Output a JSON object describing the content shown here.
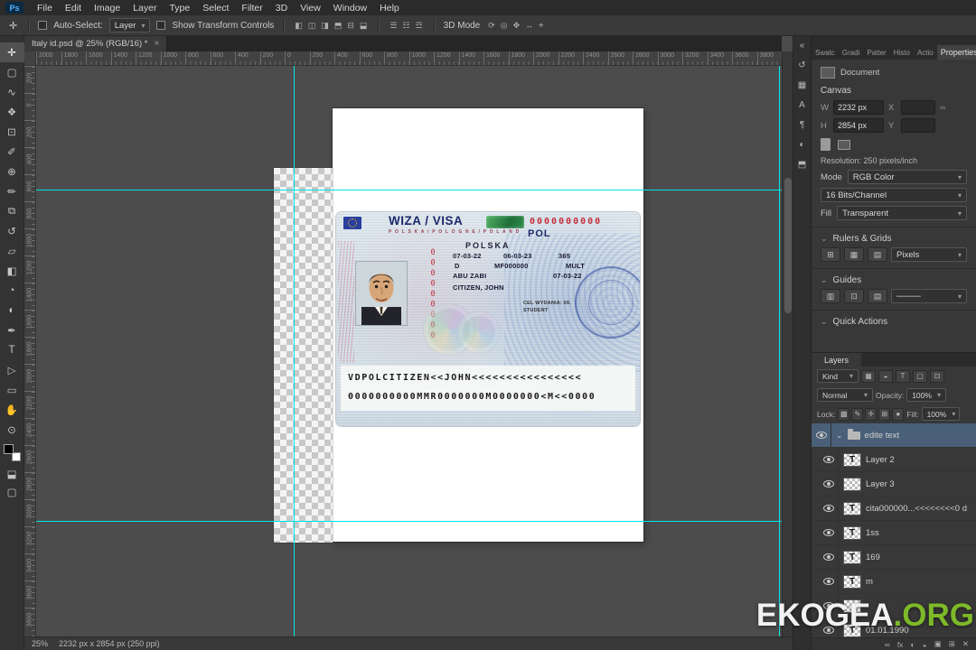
{
  "icons": {
    "caret_down": "▾",
    "chevron_down": "⌄",
    "collapse_dock": "«",
    "link": "∞",
    "close": "×"
  },
  "menubar": {
    "logo": "Ps",
    "items": [
      "File",
      "Edit",
      "Image",
      "Layer",
      "Type",
      "Select",
      "Filter",
      "3D",
      "View",
      "Window",
      "Help"
    ]
  },
  "optionsbar": {
    "tool_icon": "✛",
    "auto_select_label": "Auto-Select:",
    "auto_select_value": "Layer",
    "show_transform_label": "Show Transform Controls",
    "align_icons": [
      {
        "name": "align-left-icon",
        "glyph": "◧"
      },
      {
        "name": "align-center-h-icon",
        "glyph": "◫"
      },
      {
        "name": "align-right-icon",
        "glyph": "◨"
      },
      {
        "name": "align-top-icon",
        "glyph": "⬒"
      },
      {
        "name": "align-center-v-icon",
        "glyph": "⊟"
      },
      {
        "name": "align-bottom-icon",
        "glyph": "⬓"
      }
    ],
    "distribute_icons": [
      {
        "name": "distribute-horizontal-icon",
        "glyph": "☰"
      },
      {
        "name": "distribute-vertical-icon",
        "glyph": "☷"
      },
      {
        "name": "distribute-spacing-icon",
        "glyph": "☲"
      }
    ],
    "mode_3d_label": "3D Mode",
    "threed_icons": [
      {
        "name": "3d-rotate-icon",
        "glyph": "⟳"
      },
      {
        "name": "3d-roll-icon",
        "glyph": "◎"
      },
      {
        "name": "3d-pan-icon",
        "glyph": "✥"
      },
      {
        "name": "3d-slide-icon",
        "glyph": "↔"
      },
      {
        "name": "3d-scale-icon",
        "glyph": "⌖"
      }
    ]
  },
  "tab": {
    "title": "Italy id.psd @ 25% (RGB/16) *",
    "close": "×"
  },
  "toolbar": {
    "tools": [
      {
        "name": "move-tool",
        "glyph": "✛"
      },
      {
        "name": "marquee-tool",
        "glyph": "▢"
      },
      {
        "name": "lasso-tool",
        "glyph": "∿"
      },
      {
        "name": "quick-selection-tool",
        "glyph": "❖"
      },
      {
        "name": "crop-tool",
        "glyph": "⊡"
      },
      {
        "name": "eyedropper-tool",
        "glyph": "✐"
      },
      {
        "name": "healing-brush-tool",
        "glyph": "⊕"
      },
      {
        "name": "brush-tool",
        "glyph": "✏"
      },
      {
        "name": "clone-stamp-tool",
        "glyph": "⧉"
      },
      {
        "name": "history-brush-tool",
        "glyph": "↺"
      },
      {
        "name": "eraser-tool",
        "glyph": "▱"
      },
      {
        "name": "gradient-tool",
        "glyph": "◧"
      },
      {
        "name": "blur-tool",
        "glyph": "◔"
      },
      {
        "name": "dodge-tool",
        "glyph": "◐"
      },
      {
        "name": "pen-tool",
        "glyph": "✒"
      },
      {
        "name": "type-tool",
        "glyph": "T"
      },
      {
        "name": "path-selection-tool",
        "glyph": "▷"
      },
      {
        "name": "shape-tool",
        "glyph": "▭"
      },
      {
        "name": "hand-tool",
        "glyph": "✋"
      },
      {
        "name": "zoom-tool",
        "glyph": "⊙"
      }
    ],
    "extra_icons": [
      {
        "name": "quick-mask-icon",
        "glyph": "⬓"
      },
      {
        "name": "screen-mode-icon",
        "glyph": "▢"
      }
    ]
  },
  "dock": {
    "icons": [
      {
        "name": "collapse-dock-icon",
        "glyph": "«"
      },
      {
        "name": "history-panel-icon",
        "glyph": "↺"
      },
      {
        "name": "swatches-panel-icon",
        "glyph": "▦"
      },
      {
        "name": "character-panel-icon",
        "glyph": "A"
      },
      {
        "name": "paragraph-panel-icon",
        "glyph": "¶"
      },
      {
        "name": "adjustments-panel-icon",
        "glyph": "◐"
      },
      {
        "name": "libraries-panel-icon",
        "glyph": "⬒"
      }
    ]
  },
  "rulers": {
    "h": [
      "2000",
      "1800",
      "1600",
      "1400",
      "1200",
      "1000",
      "800",
      "600",
      "400",
      "200",
      "0",
      "200",
      "400",
      "600",
      "800",
      "1000",
      "1200",
      "1400",
      "1600",
      "1800",
      "2000",
      "2200",
      "2400",
      "2600",
      "2800",
      "3000",
      "3200",
      "3400",
      "3600",
      "3800"
    ],
    "v": [
      "200",
      "0",
      "200",
      "400",
      "600",
      "800",
      "1000",
      "1200",
      "1400",
      "1600",
      "1800",
      "2000",
      "2200",
      "2400",
      "2600",
      "2800",
      "3000",
      "3200",
      "3400",
      "3600",
      "3800"
    ]
  },
  "visa": {
    "title": "WIZA / VISA",
    "subtitle": "P O L S K A / P O L O G N E / P O L A N D",
    "serial": "0000000000",
    "country_code": "POL",
    "vertical_serial": "000000000",
    "country": "POLSKA",
    "fields": {
      "valid_from": "07-03-22",
      "valid_until": "06-03-23",
      "days": "365",
      "visa_type": "D",
      "passport_no": "MF000000",
      "entries": "MULT",
      "issued_in": "ABU ZABI",
      "issue_date": "07-03-22",
      "name": "CITIZEN, JOHN",
      "purpose_line1": "CEL WYDANIA: 09.",
      "purpose_line2": "STUDENT"
    },
    "mrz_line1": "VDPOLCITIZEN<<JOHN<<<<<<<<<<<<<<<<",
    "mrz_line2": "0000000000MMR0000000M0000000<M<<0000"
  },
  "props": {
    "tabs": [
      "Swatc",
      "Gradi",
      "Patter",
      "Histo",
      "Actio"
    ],
    "active_tab": "Properties",
    "document_label": "Document",
    "canvas_title": "Canvas",
    "w_label": "W",
    "w_value": "2232 px",
    "x_label": "X",
    "x_value": "",
    "h_label": "H",
    "h_value": "2854 px",
    "y_label": "Y",
    "y_value": "",
    "resolution_text": "Resolution: 250 pixels/inch",
    "mode_label": "Mode",
    "mode_value": "RGB Color",
    "bits_value": "16 Bits/Channel",
    "fill_label": "Fill",
    "fill_value": "Transparent",
    "rulers_title": "Rulers & Grids",
    "ruler_icons": [
      {
        "name": "toggle-rulers-icon",
        "glyph": "⊞"
      },
      {
        "name": "toggle-grid-icon",
        "glyph": "▦"
      },
      {
        "name": "snap-icon",
        "glyph": "▤"
      }
    ],
    "units_value": "Pixels",
    "guides_title": "Guides",
    "guide_icons": [
      {
        "name": "new-guide-layout-icon",
        "glyph": "▥"
      },
      {
        "name": "lock-guides-icon",
        "glyph": "⊡"
      },
      {
        "name": "clear-guides-icon",
        "glyph": "▤"
      }
    ],
    "guide_line_value": "────",
    "quick_actions_title": "Quick Actions"
  },
  "layers": {
    "tab": "Layers",
    "kind_value": "Kind",
    "filter_icons": [
      {
        "name": "filter-pixel-icon",
        "glyph": "▦"
      },
      {
        "name": "filter-adjustment-icon",
        "glyph": "◒"
      },
      {
        "name": "filter-type-icon",
        "glyph": "T"
      },
      {
        "name": "filter-shape-icon",
        "glyph": "▢"
      },
      {
        "name": "filter-smart-icon",
        "glyph": "⊡"
      }
    ],
    "blend_value": "Normal",
    "opacity_label": "Opacity:",
    "opacity_value": "100%",
    "lock_label": "Lock:",
    "lock_icons": [
      {
        "name": "lock-transparency-icon",
        "glyph": "▩"
      },
      {
        "name": "lock-pixels-icon",
        "glyph": "✎"
      },
      {
        "name": "lock-position-icon",
        "glyph": "✛"
      },
      {
        "name": "lock-artboard-icon",
        "glyph": "⊞"
      },
      {
        "name": "lock-all-icon",
        "glyph": "●"
      }
    ],
    "fill_label": "Fill:",
    "fill_value": "100%",
    "group_label": "edite text",
    "rows": [
      {
        "label": "Layer 2",
        "thumb": "T"
      },
      {
        "label": "Layer 3",
        "thumb": ""
      },
      {
        "label": "cita000000...<<<<<<<<0 d",
        "thumb": "T"
      },
      {
        "label": "1ss",
        "thumb": "T"
      },
      {
        "label": "169",
        "thumb": "T"
      },
      {
        "label": "m",
        "thumb": "T"
      },
      {
        "label": "",
        "thumb": ""
      },
      {
        "label": "01.01.1990",
        "thumb": "T"
      }
    ],
    "bottom_icons": [
      {
        "name": "link-layers-icon",
        "glyph": "∞"
      },
      {
        "name": "layer-style-icon",
        "glyph": "fx"
      },
      {
        "name": "layer-mask-icon",
        "glyph": "◐"
      },
      {
        "name": "adjustment-layer-icon",
        "glyph": "◒"
      },
      {
        "name": "new-group-icon",
        "glyph": "▣"
      },
      {
        "name": "new-layer-icon",
        "glyph": "⊞"
      },
      {
        "name": "delete-layer-icon",
        "glyph": "✕"
      }
    ]
  },
  "status": {
    "zoom": "25%",
    "doc_info": "2232 px x 2854 px (250 ppi)"
  },
  "watermark": {
    "white": "EKOGEA",
    "green": ".ORG"
  }
}
